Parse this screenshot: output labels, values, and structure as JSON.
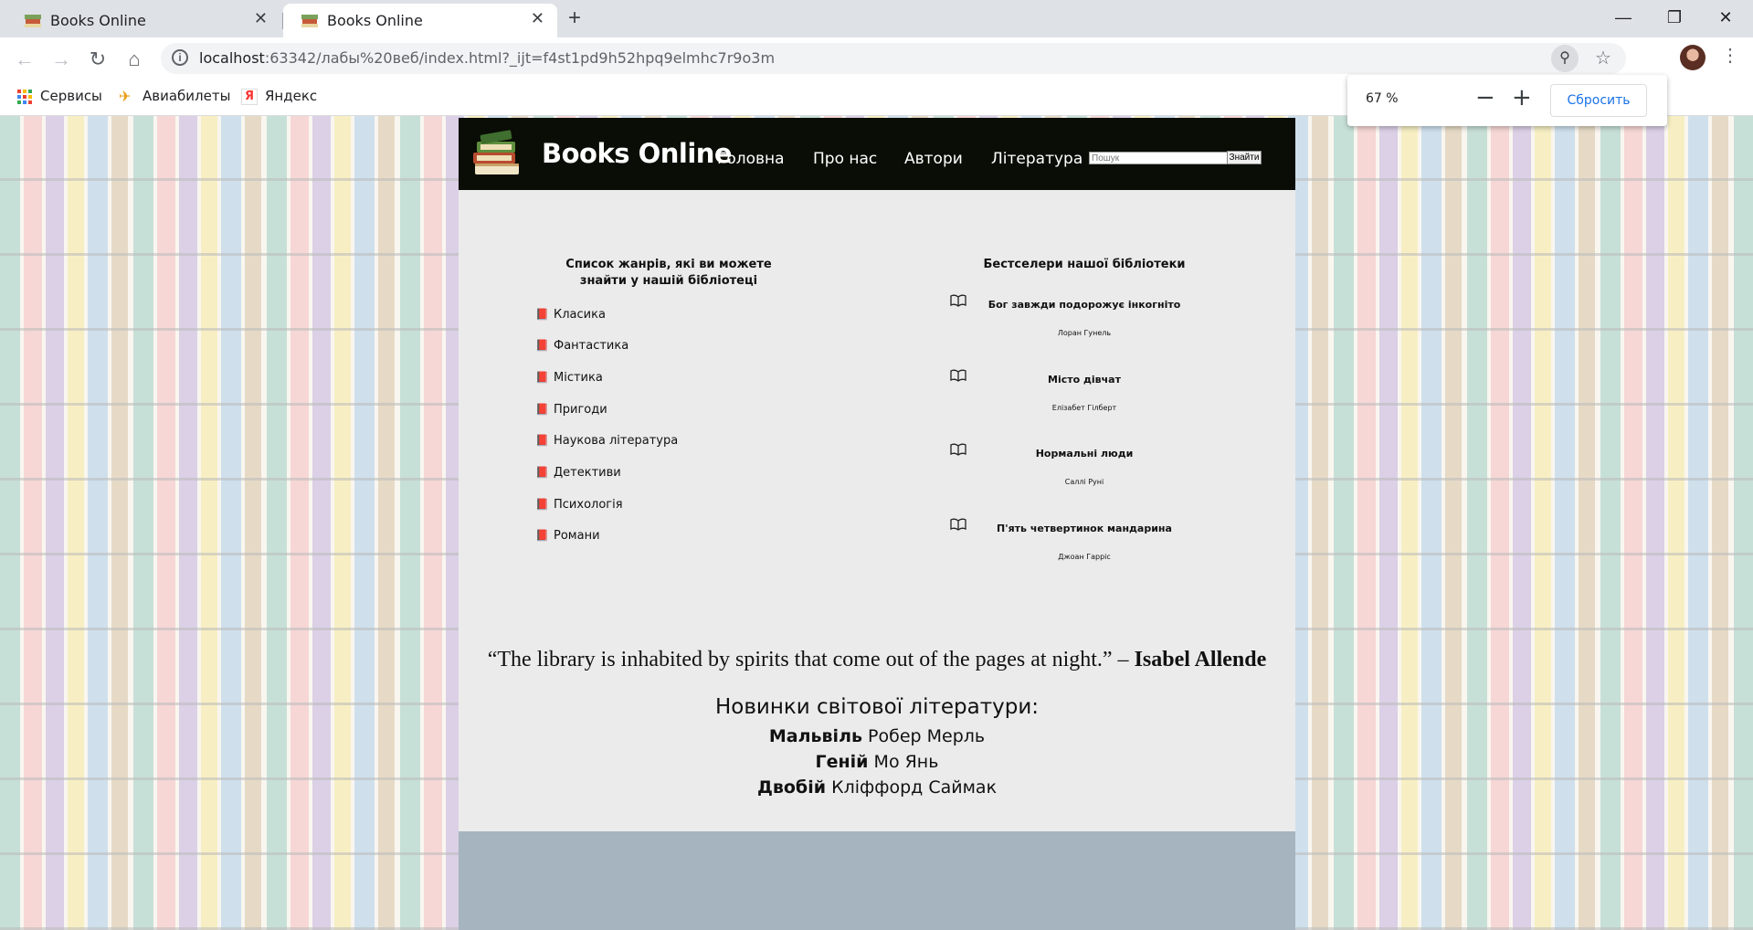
{
  "browser": {
    "tabs": [
      {
        "title": "Books Online",
        "active": false
      },
      {
        "title": "Books Online",
        "active": true
      }
    ],
    "url_host": "localhost",
    "url_rest": ":63342/лабы%20веб/index.html?_ijt=f4st1pd9h52hpq9elmhc7r9o3m",
    "bookmarks": [
      "Сервисы",
      "Авиабилеты",
      "Яндекс"
    ],
    "zoom": {
      "level": "67 %",
      "minus": "−",
      "plus": "+",
      "reset": "Сбросить"
    }
  },
  "site": {
    "title": "Books Online",
    "nav": [
      "Головна",
      "Про нас",
      "Автори",
      "Література"
    ],
    "search": {
      "placeholder": "Пошук",
      "button": "Знайти"
    },
    "genres": {
      "heading": "Список жанрів, які ви можете знайти у нашій бібліотеці",
      "items": [
        "Класика",
        "Фантастика",
        "Містика",
        "Пригоди",
        "Наукова література",
        "Детективи",
        "Психологія",
        "Романи"
      ]
    },
    "bestsellers": {
      "heading": "Бестселери нашої бібліотеки",
      "items": [
        {
          "title": "Бог завжди подорожує інкогніто",
          "author": "Лоран Гунель"
        },
        {
          "title": "Місто дівчат",
          "author": "Елізабет Гілберт"
        },
        {
          "title": "Нормальні люди",
          "author": "Саллі Руні"
        },
        {
          "title": "П'ять четвертинок мандарина",
          "author": "Джоан Гарріс"
        }
      ]
    },
    "quote": {
      "text": "“The library is inhabited by spirits that come out of the pages at night.” –",
      "author": "Isabel Allende"
    },
    "new_releases": {
      "heading": "Новинки світової літератури:",
      "items": [
        {
          "title": "Мальвіль",
          "author": "Робер Мерль"
        },
        {
          "title": "Геній",
          "author": "Мо Янь"
        },
        {
          "title": "Двобій",
          "author": "Кліффорд Саймак"
        }
      ]
    }
  },
  "colors": {
    "header_bg": "#0a0d05",
    "page_bg": "#ebebeb",
    "footer_bg": "#a6b4c0",
    "link_blue": "#1a73e8"
  }
}
